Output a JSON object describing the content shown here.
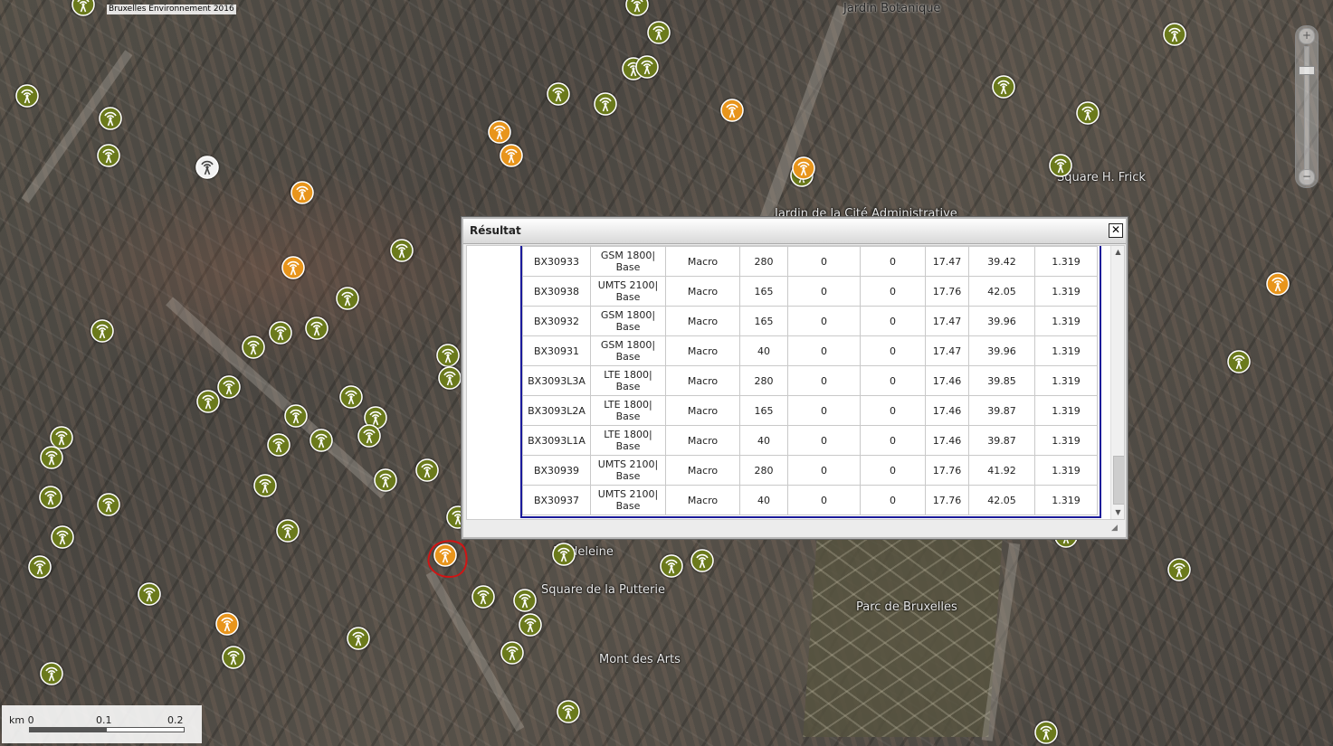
{
  "map": {
    "copyright": "Bruxelles Environnement 2016",
    "labels": [
      "Jardin Botanique",
      "Square H. Frick",
      "Jardin de la Cité Administrative",
      "Madeleine",
      "Square de la Putterie",
      "Parc de Bruxelles",
      "Mont des Arts"
    ],
    "colors": {
      "green_marker": "#6b7a1c",
      "orange_marker": "#e8951c",
      "white_marker": "#f2f2f2",
      "selection": "#d21414"
    }
  },
  "zoom": {
    "plus": "+",
    "minus": "−"
  },
  "scale": {
    "unit": "km 0",
    "mid": "0.1",
    "end": "0.2"
  },
  "dialog": {
    "title": "Résultat",
    "close_label": "✕",
    "rows": [
      [
        "BX30933",
        "GSM 1800|",
        "Base",
        "Macro",
        "280",
        "0",
        "0",
        "17.47",
        "39.42",
        "1.319"
      ],
      [
        "BX30938",
        "UMTS 2100|",
        "Base",
        "Macro",
        "165",
        "0",
        "0",
        "17.76",
        "42.05",
        "1.319"
      ],
      [
        "BX30932",
        "GSM 1800|",
        "Base",
        "Macro",
        "165",
        "0",
        "0",
        "17.47",
        "39.96",
        "1.319"
      ],
      [
        "BX30931",
        "GSM 1800|",
        "Base",
        "Macro",
        "40",
        "0",
        "0",
        "17.47",
        "39.96",
        "1.319"
      ],
      [
        "BX3093L3A",
        "LTE 1800|",
        "Base",
        "Macro",
        "280",
        "0",
        "0",
        "17.46",
        "39.85",
        "1.319"
      ],
      [
        "BX3093L2A",
        "LTE 1800|",
        "Base",
        "Macro",
        "165",
        "0",
        "0",
        "17.46",
        "39.87",
        "1.319"
      ],
      [
        "BX3093L1A",
        "LTE 1800|",
        "Base",
        "Macro",
        "40",
        "0",
        "0",
        "17.46",
        "39.87",
        "1.319"
      ],
      [
        "BX30939",
        "UMTS 2100|",
        "Base",
        "Macro",
        "280",
        "0",
        "0",
        "17.76",
        "41.92",
        "1.319"
      ],
      [
        "BX30937",
        "UMTS 2100|",
        "Base",
        "Macro",
        "40",
        "0",
        "0",
        "17.76",
        "42.05",
        "1.319"
      ]
    ]
  }
}
